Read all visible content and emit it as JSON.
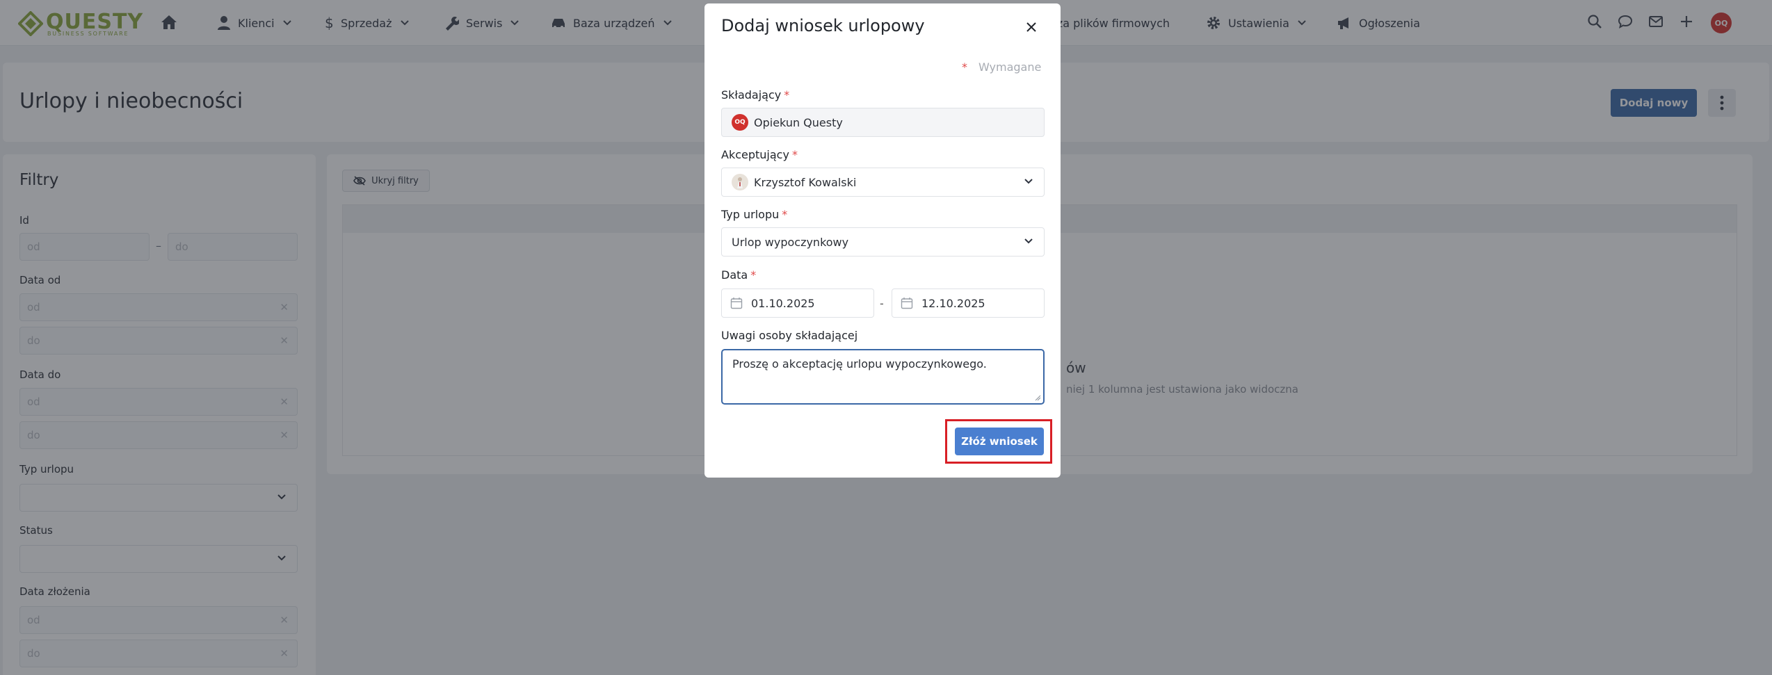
{
  "brand": {
    "name": "QUESTY",
    "tagline": "BUSINESS SOFTWARE",
    "color": "#8aa63a"
  },
  "nav": {
    "items": [
      {
        "label": "Klienci",
        "icon": "user-icon"
      },
      {
        "label": "Sprzedaż",
        "icon": "dollar-icon"
      },
      {
        "label": "Serwis",
        "icon": "wrench-icon"
      },
      {
        "label": "Baza urządzeń",
        "icon": "car-icon"
      },
      {
        "label": "aza plików firmowych",
        "icon": ""
      },
      {
        "label": "Ustawienia",
        "icon": "gear-icon"
      },
      {
        "label": "Ogłoszenia",
        "icon": "megaphone-icon"
      }
    ],
    "user_initials": "OQ"
  },
  "page": {
    "title": "Urlopy i nieobecności",
    "add_new_label": "Dodaj nowy"
  },
  "filters": {
    "title": "Filtry",
    "id_label": "Id",
    "id_from_placeholder": "od",
    "id_to_placeholder": "do",
    "date_from_label": "Data od",
    "date_to_label": "Data do",
    "from_placeholder": "od",
    "to_placeholder": "do",
    "leave_type_label": "Typ urlopu",
    "status_label": "Status",
    "submitted_date_label": "Data złożenia",
    "range_separator": "–"
  },
  "table": {
    "hide_filters_label": "Ukryj filtry",
    "empty_title": "ów",
    "empty_subtitle": "niej 1 kolumna jest ustawiona jako widoczna"
  },
  "modal": {
    "title": "Dodaj wniosek urlopowy",
    "required_star": "*",
    "required_note": "Wymagane",
    "applicant_label": "Składający",
    "applicant_value": "Opiekun Questy",
    "applicant_initials": "OQ",
    "approver_label": "Akceptujący",
    "approver_value": "Krzysztof Kowalski",
    "leave_type_label": "Typ urlopu",
    "leave_type_value": "Urlop wypoczynkowy",
    "date_label": "Data",
    "date_from": "01.10.2025",
    "date_to": "12.10.2025",
    "date_separator": "-",
    "notes_label": "Uwagi osoby składającej",
    "notes_value": "Proszę o akceptację urlopu wypoczynkowego.",
    "submit_label": "Złóż wniosek"
  },
  "colors": {
    "primary": "#3b68a6",
    "submit": "#4a7fd0",
    "highlight": "#d81f26",
    "danger": "#e04a4a"
  }
}
